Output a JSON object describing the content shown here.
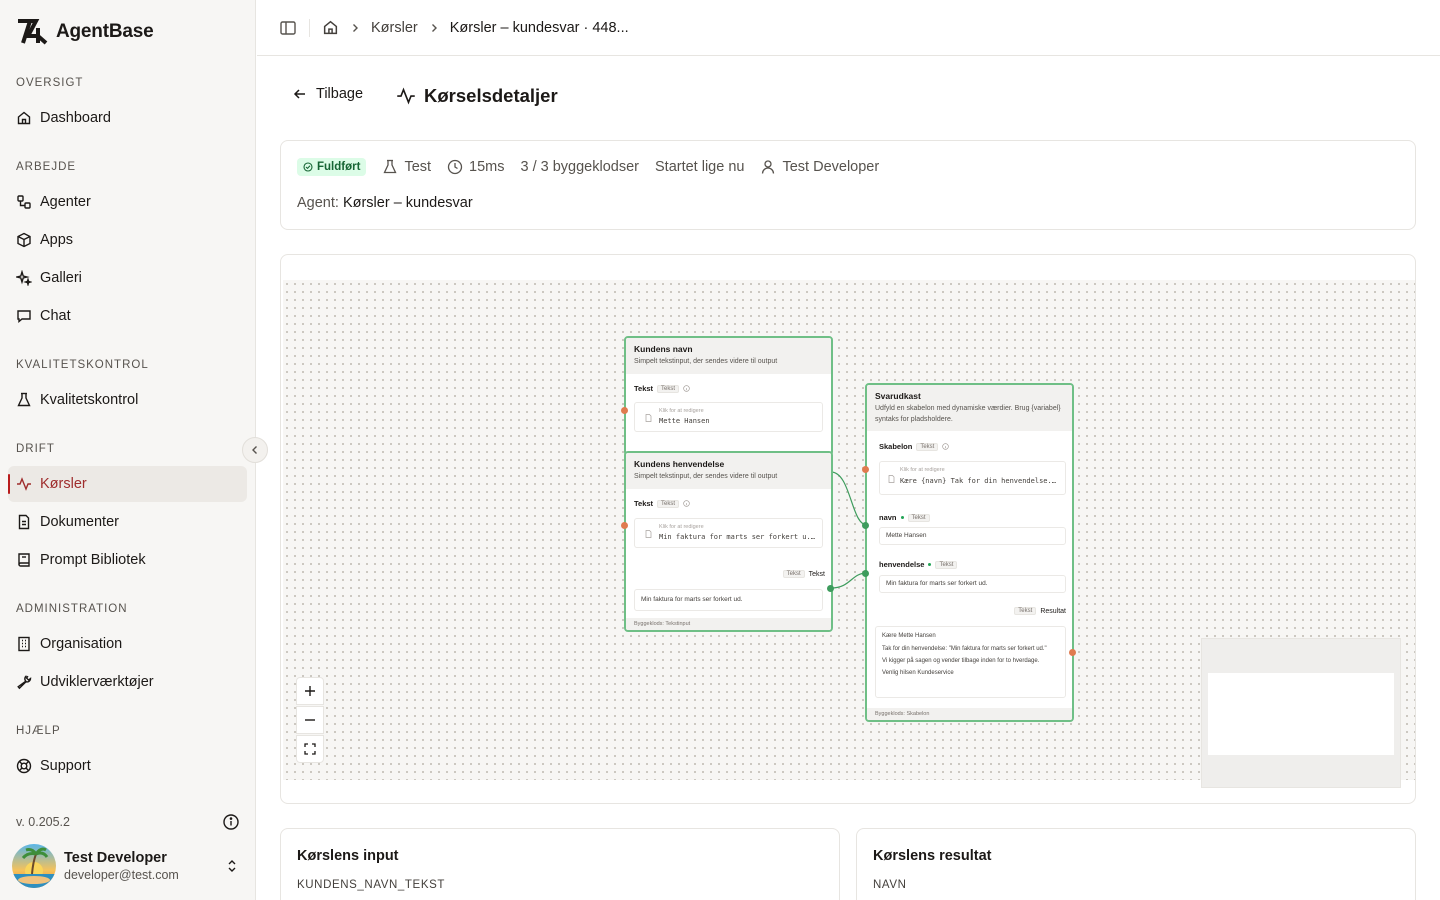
{
  "app": {
    "name": "AgentBase"
  },
  "sidebar": {
    "sections": [
      {
        "title": "OVERSIGT",
        "items": [
          {
            "label": "Dashboard",
            "icon": "home-icon"
          }
        ]
      },
      {
        "title": "ARBEJDE",
        "items": [
          {
            "label": "Agenter",
            "icon": "workflow-icon"
          },
          {
            "label": "Apps",
            "icon": "box-icon"
          },
          {
            "label": "Galleri",
            "icon": "sparkles-icon"
          },
          {
            "label": "Chat",
            "icon": "chat-icon"
          }
        ]
      },
      {
        "title": "KVALITETSKONTROL",
        "items": [
          {
            "label": "Kvalitetskontrol",
            "icon": "flask-icon"
          }
        ]
      },
      {
        "title": "DRIFT",
        "items": [
          {
            "label": "Kørsler",
            "icon": "activity-icon",
            "active": true
          },
          {
            "label": "Dokumenter",
            "icon": "document-icon"
          },
          {
            "label": "Prompt Bibliotek",
            "icon": "book-icon"
          }
        ]
      },
      {
        "title": "ADMINISTRATION",
        "items": [
          {
            "label": "Organisation",
            "icon": "building-icon"
          },
          {
            "label": "Udviklerværktøjer",
            "icon": "wrench-icon"
          }
        ]
      },
      {
        "title": "HJÆLP",
        "items": [
          {
            "label": "Support",
            "icon": "lifebuoy-icon"
          }
        ]
      }
    ],
    "version": "v. 0.205.2",
    "user": {
      "name": "Test Developer",
      "email": "developer@test.com"
    }
  },
  "breadcrumb": {
    "section": "Kørsler",
    "current": "Kørsler – kundesvar · 448..."
  },
  "header": {
    "back_label": "Tilbage",
    "title": "Kørselsdetaljer"
  },
  "summary": {
    "status": "Fuldført",
    "mode": "Test",
    "duration": "15ms",
    "blocks": "3 / 3 byggeklodser",
    "started": "Startet lige nu",
    "user": "Test Developer",
    "agent_label": "Agent:",
    "agent_name": "Kørsler – kundesvar"
  },
  "flow": {
    "node1": {
      "title": "Kundens navn",
      "desc": "Simpelt tekstinput, der sendes videre til output",
      "field_label": "Tekst",
      "field_type": "Tekst",
      "edit_hint": "Klik for at redigere",
      "value": "Mette Hansen"
    },
    "node2": {
      "title": "Kundens henvendelse",
      "desc": "Simpelt tekstinput, der sendes videre til output",
      "field_label": "Tekst",
      "field_type": "Tekst",
      "edit_hint": "Klik for at redigere",
      "value": "Min faktura for marts ser forkert u...",
      "output_type": "Tekst",
      "output_label": "Tekst",
      "output_value": "Min faktura for marts ser forkert ud.",
      "footer": "Byggeklods: Tekstinput"
    },
    "node3": {
      "title": "Svarudkast",
      "desc": "Udfyld en skabelon med dynamiske værdier. Brug {variabel} syntaks for pladsholdere.",
      "field_label": "Skabelon",
      "field_type": "Tekst",
      "edit_hint": "Klik for at redigere",
      "template": "Kære {navn} Tak for din henvendelse...",
      "var1_label": "navn",
      "var1_type": "Tekst",
      "var1_value": "Mette Hansen",
      "var2_label": "henvendelse",
      "var2_type": "Tekst",
      "var2_value": "Min faktura for marts ser forkert ud.",
      "output_type": "Tekst",
      "output_label": "Resultat",
      "result_line1": "Kære Mette Hansen",
      "result_line2": "Tak for din henvendelse: \"Min faktura for marts ser forkert ud.\"",
      "result_line3": "Vi kigger på sagen og vender tilbage inden for to hverdage.",
      "result_line4": "Venlig hilsen Kundeservice",
      "footer": "Byggeklods: Skabelon"
    }
  },
  "input_card": {
    "title": "Kørslens input",
    "field": "KUNDENS_NAVN_TEKST"
  },
  "result_card": {
    "title": "Kørslens resultat",
    "field": "NAVN"
  },
  "colors": {
    "accent": "#b91c1c",
    "node_border": "#6fbf86",
    "success_bg": "#dcfce7",
    "success_text": "#166534"
  }
}
